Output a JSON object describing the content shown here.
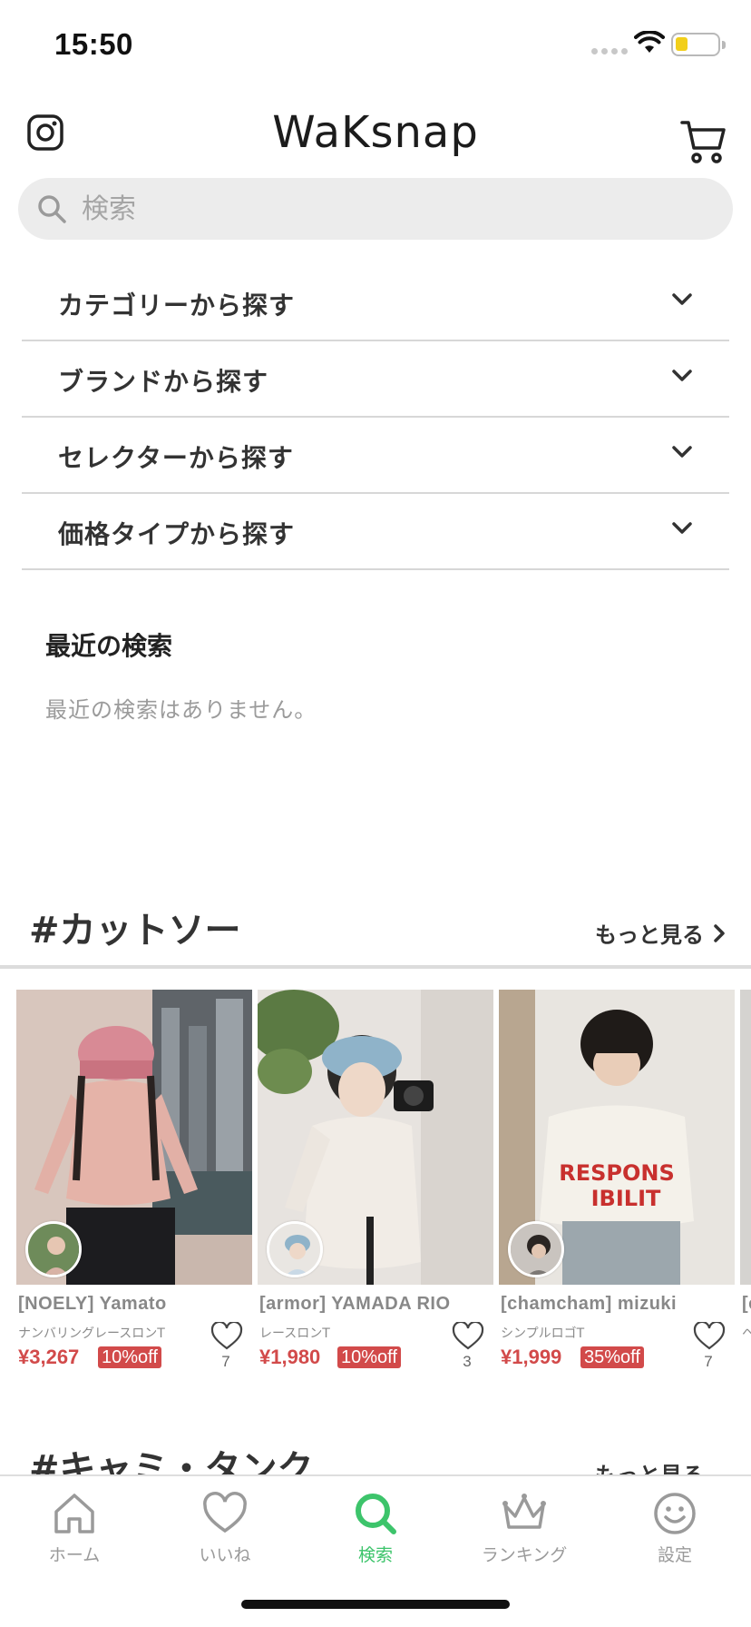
{
  "status_bar": {
    "time": "15:50"
  },
  "header": {
    "logo": "WaKsnap"
  },
  "search": {
    "placeholder": "検索"
  },
  "browse": {
    "items": [
      {
        "label": "カテゴリーから探す"
      },
      {
        "label": "ブランドから探す"
      },
      {
        "label": "セレクターから探す"
      },
      {
        "label": "価格タイプから探す"
      }
    ]
  },
  "recent": {
    "title": "最近の検索",
    "empty_message": "最近の検索はありません。"
  },
  "section": {
    "title": "#カットソー",
    "more_label": "もっと見る",
    "products": [
      {
        "seller": "[NOELY] Yamato",
        "name": "ナンバリングレースロンT",
        "price": "¥3,267",
        "discount": "10%off",
        "likes": "7"
      },
      {
        "seller": "[armor] YAMADA RIO",
        "name": "レースロンT",
        "price": "¥1,980",
        "discount": "10%off",
        "likes": "3"
      },
      {
        "seller": "[chamcham] mizuki",
        "name": "シンプルロゴT",
        "price": "¥1,999",
        "discount": "35%off",
        "likes": "7"
      },
      {
        "seller": "[c",
        "name": "ヘ",
        "price": "",
        "discount": "",
        "likes": ""
      }
    ]
  },
  "section2": {
    "title": "#キャミ・タンク",
    "more_label": "もっと見る"
  },
  "tab_bar": {
    "tabs": [
      {
        "label": "ホーム",
        "icon": "home-icon"
      },
      {
        "label": "いいね",
        "icon": "heart-icon"
      },
      {
        "label": "検索",
        "icon": "search-icon",
        "active": true
      },
      {
        "label": "ランキング",
        "icon": "crown-icon"
      },
      {
        "label": "設定",
        "icon": "smiley-icon"
      }
    ]
  },
  "colors": {
    "accent": "#3dc46b",
    "price": "#d24a4a"
  }
}
